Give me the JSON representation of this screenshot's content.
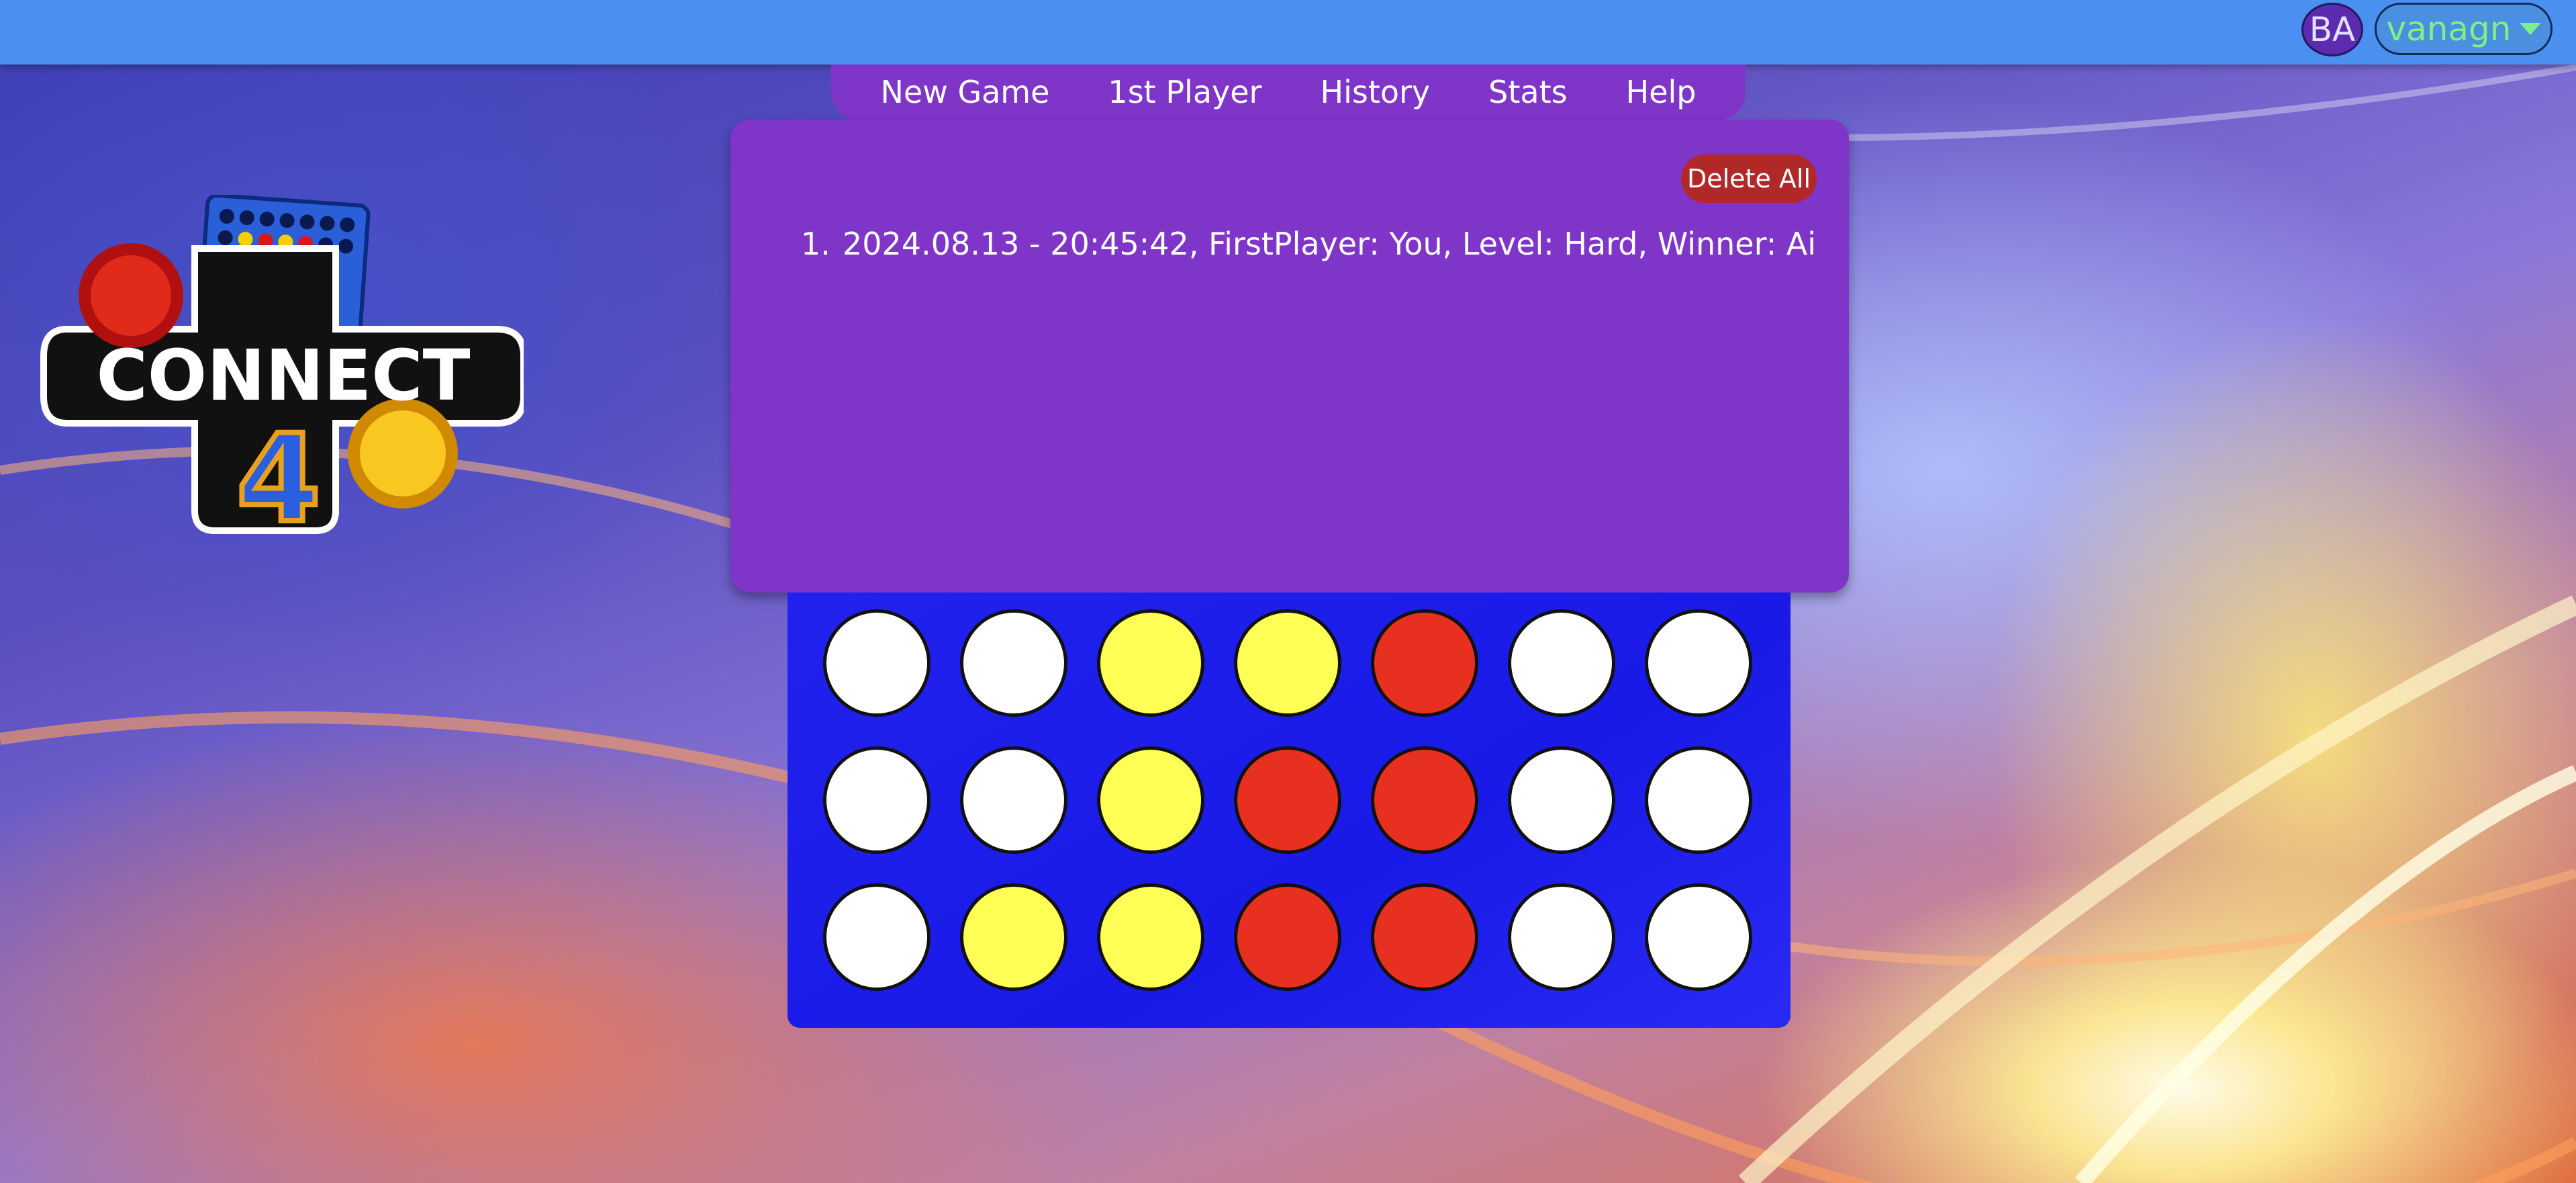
{
  "user": {
    "initials": "BA",
    "name": "vanagn"
  },
  "menu": [
    "New Game",
    "1st Player",
    "History",
    "Stats",
    "Help"
  ],
  "history": {
    "delete_label": "Delete All",
    "entries": [
      {
        "number": "1.",
        "text": "2024.08.13 - 20:45:42, FirstPlayer: You, Level: Hard, Winner: Ai"
      }
    ]
  },
  "logo": {
    "text": "CONNECT",
    "digit": "4"
  },
  "board": {
    "colors": {
      "empty": "#ffffff",
      "yellow": "#ffff55",
      "red": "#e83020",
      "frame": "#1f1ff0"
    },
    "rows": [
      [
        "empty",
        "empty",
        "yellow",
        "yellow",
        "red",
        "empty",
        "empty"
      ],
      [
        "empty",
        "empty",
        "yellow",
        "red",
        "red",
        "empty",
        "empty"
      ],
      [
        "empty",
        "yellow",
        "yellow",
        "red",
        "red",
        "empty",
        "empty"
      ]
    ]
  }
}
